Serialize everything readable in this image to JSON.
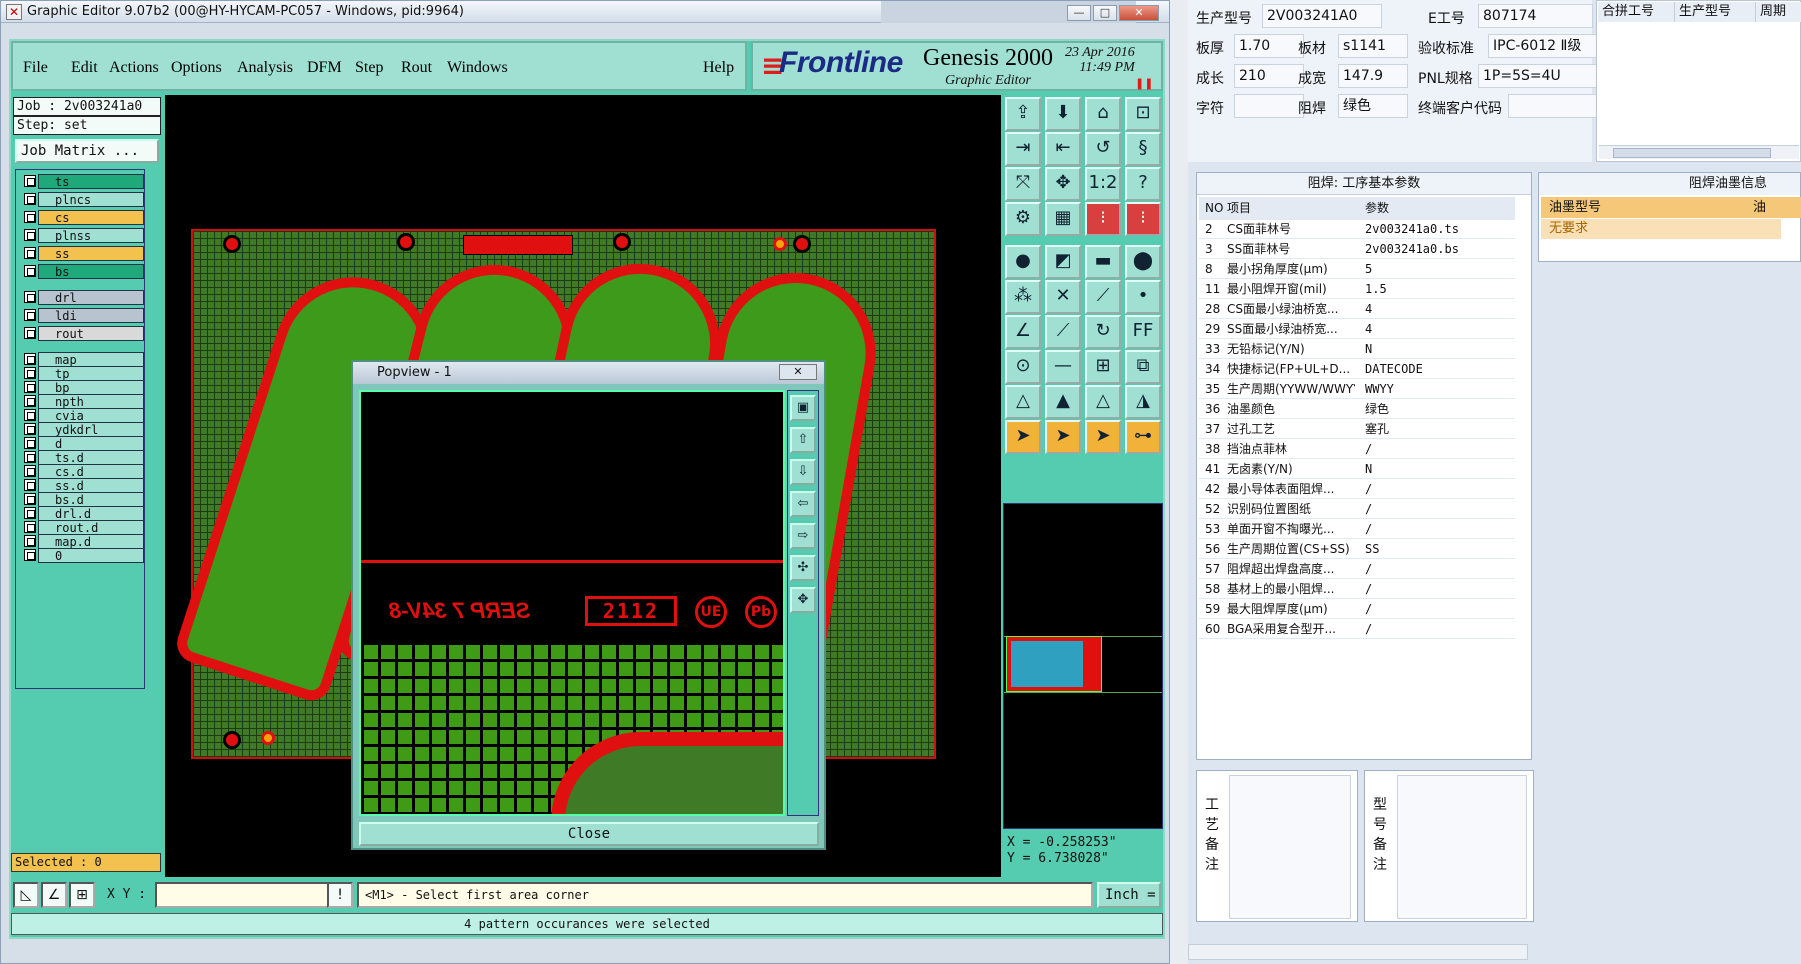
{
  "window": {
    "title": "Graphic Editor 9.07b2 (00@HY-HYCAM-PC057 - Windows, pid:9964)",
    "minimize": "—",
    "maximize": "□",
    "close": "✕"
  },
  "menu": {
    "items": [
      "File",
      "Edit",
      "Actions",
      "Options",
      "Analysis",
      "DFM",
      "Step",
      "Rout",
      "Windows"
    ],
    "help": "Help"
  },
  "logo": {
    "brand": "Frontline",
    "product": "Genesis 2000",
    "subtitle": "Graphic Editor",
    "date": "23 Apr 2016",
    "time": "11:49 PM"
  },
  "job": {
    "job_label": "Job : 2v003241a0",
    "step_label": "Step: set",
    "matrix_button": "Job Matrix ..."
  },
  "layers": [
    {
      "name": "ts",
      "color": "#1fa87a"
    },
    {
      "name": "plncs",
      "color": "#9fe0d2"
    },
    {
      "name": "cs",
      "color": "#f2c14e"
    },
    {
      "name": "plnss",
      "color": "#9fe0d2"
    },
    {
      "name": "ss",
      "color": "#f2c14e"
    },
    {
      "name": "bs",
      "color": "#1fa87a"
    },
    {
      "name": "drl",
      "color": "#b7c4cf"
    },
    {
      "name": "ldi",
      "color": "#b7c4cf"
    },
    {
      "name": "rout",
      "color": "#d9d9d9"
    },
    {
      "name": "map",
      "color": "#9fe0d2"
    },
    {
      "name": "tp",
      "color": "#9fe0d2"
    },
    {
      "name": "bp",
      "color": "#9fe0d2"
    },
    {
      "name": "npth",
      "color": "#9fe0d2"
    },
    {
      "name": "cvia",
      "color": "#9fe0d2"
    },
    {
      "name": "ydkdrl",
      "color": "#9fe0d2"
    },
    {
      "name": "d",
      "color": "#9fe0d2"
    },
    {
      "name": "ts.d",
      "color": "#9fe0d2"
    },
    {
      "name": "cs.d",
      "color": "#9fe0d2"
    },
    {
      "name": "ss.d",
      "color": "#9fe0d2"
    },
    {
      "name": "bs.d",
      "color": "#9fe0d2"
    },
    {
      "name": "drl.d",
      "color": "#9fe0d2"
    },
    {
      "name": "rout.d",
      "color": "#9fe0d2"
    },
    {
      "name": "map.d",
      "color": "#9fe0d2"
    },
    {
      "name": "0",
      "color": "#9fe0d2"
    }
  ],
  "selected_label": "Selected : 0",
  "popview": {
    "title": "Popview - 1",
    "close_x": "✕",
    "close_button": "Close",
    "board_text": "SERP 7 34V-8",
    "box_text": "2112",
    "circle1": "UE",
    "circle2": "Pb"
  },
  "coords": {
    "x": "X = -0.258253\"",
    "y": "Y = 6.738028\""
  },
  "bottom": {
    "xy_label": "X Y :",
    "xy_value": "",
    "prompt": "<M1> - Select first area corner",
    "unit": "Inch ="
  },
  "status": "4 pattern occurances were selected",
  "info": {
    "fields": [
      {
        "label": "生产型号",
        "value": "2V003241A0"
      },
      {
        "label": "E工号",
        "value": "807174"
      },
      {
        "label": "板厚",
        "value": "1.70"
      },
      {
        "label": "板材",
        "value": "s1141"
      },
      {
        "label": "验收标准",
        "value": "IPC-6012 Ⅱ级"
      },
      {
        "label": "成长",
        "value": "210"
      },
      {
        "label": "成宽",
        "value": "147.9"
      },
      {
        "label": "PNL规格",
        "value": "1P=5S=4U"
      },
      {
        "label": "字符",
        "value": ""
      },
      {
        "label": "阻焊",
        "value": "绿色"
      },
      {
        "label": "终端客户代码",
        "value": ""
      }
    ]
  },
  "merge_table": {
    "headers": [
      "合拼工号",
      "生产型号",
      "周期"
    ]
  },
  "params": {
    "title": "阻焊: 工序基本参数",
    "headers": [
      "NO",
      "项目",
      "参数"
    ],
    "rows": [
      {
        "no": "2",
        "item": "CS面菲林号",
        "value": "2v003241a0.ts"
      },
      {
        "no": "3",
        "item": "SS面菲林号",
        "value": "2v003241a0.bs"
      },
      {
        "no": "8",
        "item": "最小拐角厚度(μm)",
        "value": "5"
      },
      {
        "no": "11",
        "item": "最小阻焊开窗(mil)",
        "value": "1.5"
      },
      {
        "no": "28",
        "item": "CS面最小绿油桥宽...",
        "value": "4"
      },
      {
        "no": "29",
        "item": "SS面最小绿油桥宽...",
        "value": "4"
      },
      {
        "no": "33",
        "item": "无铅标记(Y/N)",
        "value": "N"
      },
      {
        "no": "34",
        "item": "快捷标记(FP+UL+D...",
        "value": "DATECODE"
      },
      {
        "no": "35",
        "item": "生产周期(YYWW/WWYY)",
        "value": "WWYY"
      },
      {
        "no": "36",
        "item": "油墨颜色",
        "value": "绿色"
      },
      {
        "no": "37",
        "item": "过孔工艺",
        "value": "塞孔"
      },
      {
        "no": "38",
        "item": "挡油点菲林",
        "value": "/"
      },
      {
        "no": "41",
        "item": "无卤素(Y/N)",
        "value": "N"
      },
      {
        "no": "42",
        "item": "最小导体表面阻焊...",
        "value": "/"
      },
      {
        "no": "52",
        "item": "识别码位置图纸",
        "value": "/"
      },
      {
        "no": "53",
        "item": "单面开窗不掏曝光...",
        "value": "/"
      },
      {
        "no": "56",
        "item": "生产周期位置(CS+SS)",
        "value": "SS"
      },
      {
        "no": "57",
        "item": "阻焊超出焊盘高度...",
        "value": "/"
      },
      {
        "no": "58",
        "item": "基材上的最小阻焊...",
        "value": "/"
      },
      {
        "no": "59",
        "item": "最大阻焊厚度(μm)",
        "value": "/"
      },
      {
        "no": "60",
        "item": "BGA采用复合型开...",
        "value": "/"
      }
    ]
  },
  "oil": {
    "title": "阻焊油墨信息",
    "header": "油墨型号",
    "header2": "油",
    "row": "无要求"
  },
  "notes": {
    "process_label": "工艺备注",
    "model_label": "型号备注"
  }
}
